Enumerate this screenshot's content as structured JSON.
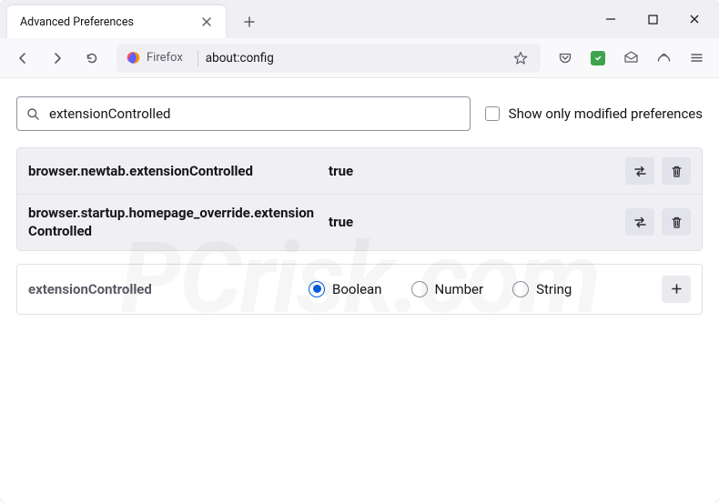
{
  "tab": {
    "title": "Advanced Preferences"
  },
  "urlbar": {
    "identity": "Firefox",
    "url": "about:config"
  },
  "search": {
    "value": "extensionControlled",
    "checkbox_label": "Show only modified preferences"
  },
  "prefs": [
    {
      "name": "browser.newtab.extensionControlled",
      "value": "true"
    },
    {
      "name": "browser.startup.homepage_override.extensionControlled",
      "value": "true"
    }
  ],
  "newpref": {
    "name": "extensionControlled",
    "options": [
      "Boolean",
      "Number",
      "String"
    ],
    "selected": "Boolean"
  },
  "watermark": "PCrisk.com"
}
